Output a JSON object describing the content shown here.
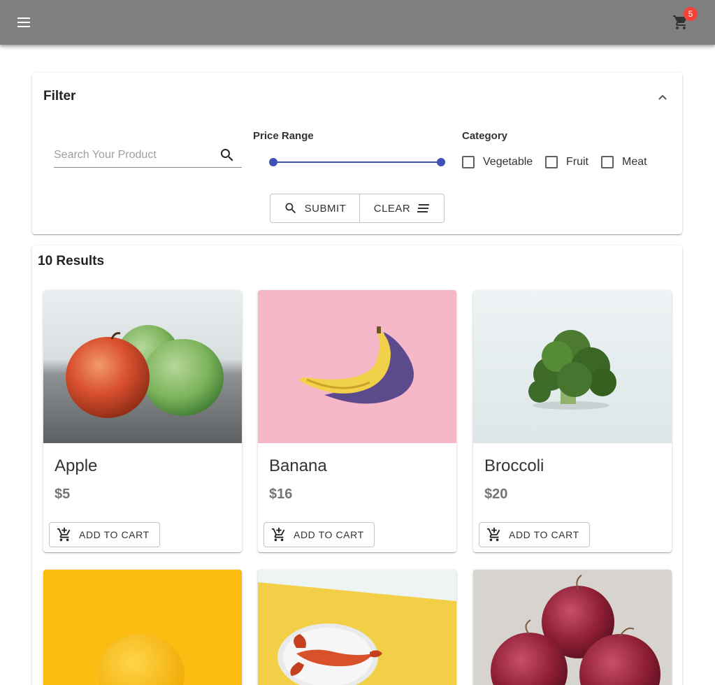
{
  "header": {
    "menu_icon": "menu-icon",
    "cart_icon": "shopping-cart-icon",
    "cart_count": "5",
    "background": "#808080",
    "badge_color": "#f44336"
  },
  "filter": {
    "title": "Filter",
    "collapse_icon": "chevron-up-icon",
    "search": {
      "placeholder": "Search Your Product",
      "value": ""
    },
    "price_range": {
      "label": "Price Range",
      "accent": "#3f51b5",
      "min_fraction": 0,
      "max_fraction": 1
    },
    "category": {
      "label": "Category",
      "options": [
        {
          "label": "Vegetable",
          "checked": false
        },
        {
          "label": "Fruit",
          "checked": false
        },
        {
          "label": "Meat",
          "checked": false
        }
      ]
    },
    "submit_label": "SUBMIT",
    "clear_label": "CLEAR"
  },
  "results": {
    "count_label": "10 Results",
    "add_to_cart_label": "ADD TO CART",
    "products": [
      {
        "name": "Apple",
        "price": "$5"
      },
      {
        "name": "Banana",
        "price": "$16"
      },
      {
        "name": "Broccoli",
        "price": "$20"
      }
    ]
  }
}
